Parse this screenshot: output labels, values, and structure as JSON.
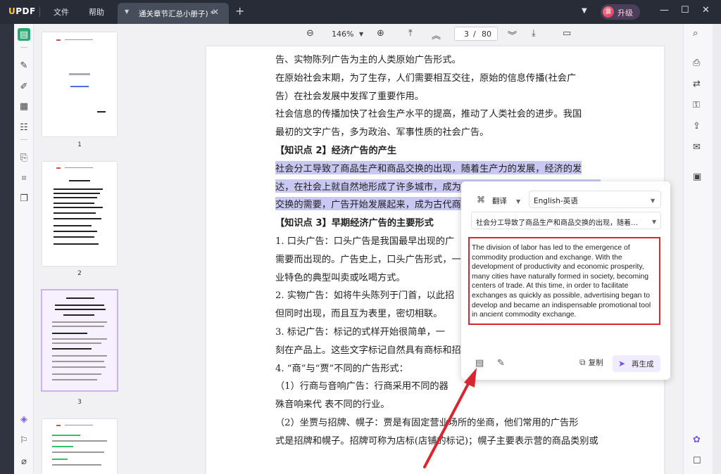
{
  "titlebar": {
    "logo": "UPDF",
    "menu": [
      "文件",
      "帮助"
    ],
    "tab_title": "通关章节汇总小册子) *",
    "upgrade_label": "升级",
    "avatar_initial": "晨"
  },
  "toolbar": {
    "zoom": "146%",
    "current_page": "3",
    "page_separator": "/",
    "total_pages": "80"
  },
  "thumbnails": [
    {
      "label": "1"
    },
    {
      "label": "2"
    },
    {
      "label": "3",
      "active": true
    },
    {
      "label": ""
    }
  ],
  "document": {
    "lines": [
      {
        "text": "告、实物陈列广告为主的人类原始广告形式。"
      },
      {
        "text": "    在原始社会末期，为了生存，人们需要相互交往，原始的信息传播(社会广"
      },
      {
        "text": "告）在社会发展中发挥了重要作用。"
      },
      {
        "text": "    社会信息的传播加快了社会生产水平的提高，推动了人类社会的进步。我国"
      },
      {
        "text": "最初的文字广告，多为政治、军事性质的社会广告。"
      },
      {
        "text": "【知识点 2】经济广告的产生",
        "heading": true
      },
      {
        "text": "    社会分工导致了商品生产和商品交换的出现，随着生产力的发展，经济的发",
        "highlight": true
      },
      {
        "text": "达，在社会上就自然地形成了许多城市，成为交易的中心。此时，由于尽快实成",
        "highlight": true
      },
      {
        "text": "交换的需要，广告开始发展起来，成为古代商品",
        "highlight": true
      },
      {
        "text": "【知识点 3】早期经济广告的主要形式",
        "heading": true
      },
      {
        "text": "    1. 口头广告：口头广告是我国最早出现的广"
      },
      {
        "text": "需要而出现的。广告史上，口头广告形式，一直"
      },
      {
        "text": "业特色的典型叫卖或吆喝方式。"
      },
      {
        "text": "    2. 实物广告：如将牛头陈列于门首，以此招"
      },
      {
        "text": "但同时出现，而且互为表里，密切相联。"
      },
      {
        "text": "    3.  标记广告：标记的式样开始很简单，一"
      },
      {
        "text": "刻在产品上。这些文字标记自然具有商标和招"
      },
      {
        "text": "    4.  “商”与“贾”不同的广告形式："
      },
      {
        "text": "    （1）行商与音响广告：行商采用不同的器"
      },
      {
        "text": "殊音响来代  表不同的行业。"
      },
      {
        "text": "    （2）坐贾与招牌、幌子：贾是有固定营业场所的坐商，他们常用的广告形"
      },
      {
        "text": "式是招牌和幌子。招牌可称为店标(店铺的标记)；幌子主要表示营的商品类别或"
      }
    ]
  },
  "translate_popup": {
    "mode": "翻译",
    "language": "English-英语",
    "source_text": "社会分工导致了商品生产和商品交换的出现，随着生...",
    "result_text": "The division of labor has led to the emergence of commodity production and exchange. With the development of productivity and economic prosperity, many cities have naturally formed in society, becoming centers of trade. At this time, in order to facilitate exchanges as quickly as possible, advertising began to develop and became an indispensable promotional tool in ancient commodity exchange.",
    "copy_label": "复制",
    "regenerate_label": "再生成"
  },
  "colors": {
    "titlebar": "#282c36",
    "highlight": "#c8c8f2",
    "annotation_red": "#d9262e",
    "accent_purple": "#6a4ff0",
    "active_tool_green": "#2aa872"
  },
  "icons": [
    "reader-mode-icon",
    "comment-icon",
    "edit-icon",
    "organize-icon",
    "form-icon",
    "protect-icon",
    "crop-icon",
    "stamp-icon",
    "layers-icon",
    "bookmark-icon",
    "attachment-icon",
    "zoom-out-icon",
    "zoom-in-icon",
    "first-page-icon",
    "prev-page-icon",
    "next-page-icon",
    "last-page-icon",
    "presentation-icon",
    "search-icon",
    "ocr-icon",
    "convert-icon",
    "protect-file-icon",
    "share-icon",
    "email-icon",
    "save-icon",
    "ai-icon",
    "feedback-icon"
  ]
}
